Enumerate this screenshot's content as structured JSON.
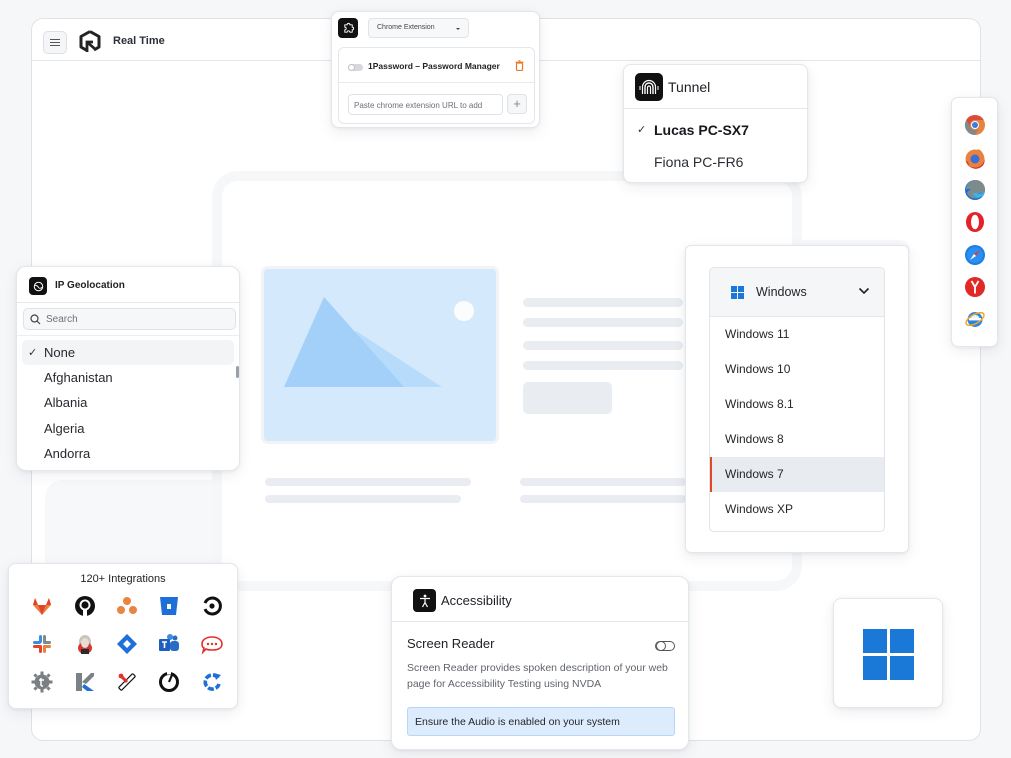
{
  "app": {
    "title": "Real Time",
    "menu_icon": "hamburger-menu-icon",
    "logo_icon": "lambdatest-logo-icon"
  },
  "chrome_extension": {
    "icon": "puzzle-piece-icon",
    "selector_label": "Chrome Extension",
    "extension_name": "1Password – Password Manager",
    "extension_enabled": false,
    "delete_icon": "trash-icon",
    "url_input_placeholder": "Paste chrome extension URL to add",
    "add_button_label": "+"
  },
  "tunnel": {
    "icon": "tunnel-icon",
    "title": "Tunnel",
    "options": [
      {
        "label": "Lucas PC-SX7",
        "selected": true
      },
      {
        "label": "Fiona PC-FR6",
        "selected": false
      }
    ],
    "check_glyph": "✓"
  },
  "browsers": [
    {
      "name": "chrome",
      "icon": "chrome-icon"
    },
    {
      "name": "firefox",
      "icon": "firefox-icon"
    },
    {
      "name": "edge",
      "icon": "edge-icon"
    },
    {
      "name": "opera",
      "icon": "opera-icon"
    },
    {
      "name": "safari",
      "icon": "safari-icon"
    },
    {
      "name": "yandex",
      "icon": "yandex-icon"
    },
    {
      "name": "internet-explorer",
      "icon": "internet-explorer-icon"
    }
  ],
  "geolocation": {
    "icon": "globe-icon",
    "title": "IP Geolocation",
    "search_placeholder": "Search",
    "check_glyph": "✓",
    "countries": [
      "None",
      "Afghanistan",
      "Albania",
      "Algeria",
      "Andorra"
    ],
    "selected": "None"
  },
  "os_selector": {
    "current": "Windows",
    "versions": [
      "Windows 11",
      "Windows 10",
      "Windows 8.1",
      "Windows 8",
      "Windows 7",
      "Windows XP"
    ],
    "active": "Windows 7",
    "active_accent": "#e0492b"
  },
  "integrations": {
    "title": "120+ Integrations",
    "items": [
      "gitlab",
      "github",
      "asana",
      "bitbucket",
      "circleci",
      "slack",
      "jenkins",
      "jira",
      "microsoft-teams",
      "rocket-chat",
      "gear-addon",
      "kanbanize",
      "tools",
      "clock-app",
      "refresh-app"
    ]
  },
  "accessibility": {
    "icon": "accessibility-person-icon",
    "title": "Accessibility",
    "feature_title": "Screen Reader",
    "feature_enabled": false,
    "description": "Screen Reader provides spoken description of your web page for Accessibility Testing using NVDA",
    "note": "Ensure the Audio is enabled on your system"
  },
  "windows_tile": {
    "icon": "windows-logo-icon",
    "brand_color": "#1a78d6"
  }
}
